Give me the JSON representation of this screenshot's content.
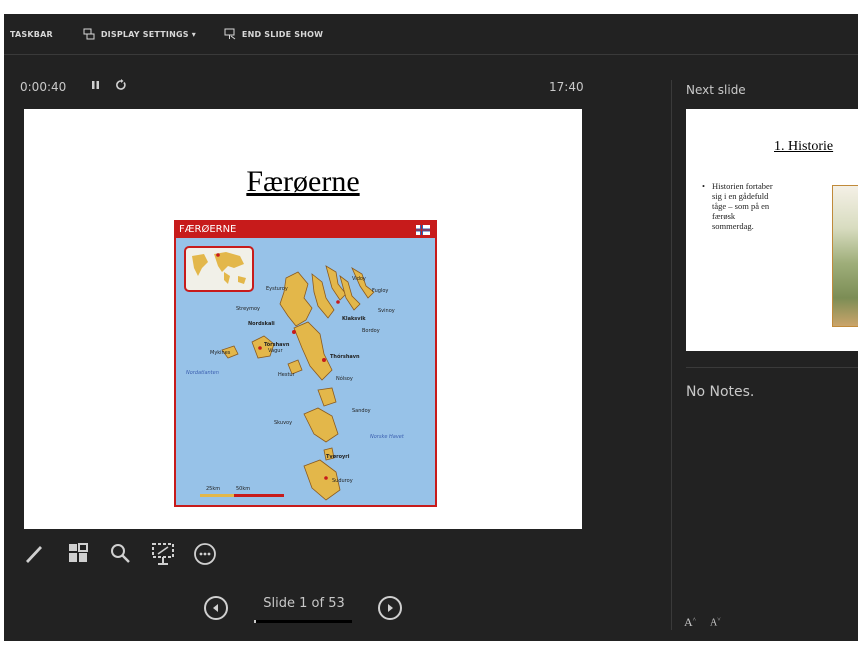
{
  "toolbar": {
    "items": [
      {
        "label": "TASKBAR",
        "icon": "taskbar-icon"
      },
      {
        "label": "DISPLAY SETTINGS ▾",
        "icon": "display-settings-icon"
      },
      {
        "label": "END SLIDE SHOW",
        "icon": "end-slideshow-icon"
      }
    ]
  },
  "presenter": {
    "elapsed": "0:00:40",
    "clock": "17:40",
    "pause_icon": "pause-icon",
    "restart_icon": "restart-icon"
  },
  "current_slide": {
    "title": "Færøerne",
    "map": {
      "header": "FÆRØERNE",
      "places": [
        "Vidoy",
        "Eysturoy",
        "Fugloy",
        "Streymoy",
        "Svinoy",
        "Klaksvik",
        "Nordskali",
        "Tórshavn",
        "Vagur",
        "Bordoy",
        "Mykines",
        "Thórshavn",
        "Hestur",
        "Nólsoy",
        "Sandoy",
        "Skuvoy",
        "Suduroy",
        "Tvøroyri"
      ],
      "seas": [
        "Nordatlanten",
        "Norske Havet"
      ],
      "scale": [
        "25km",
        "50km"
      ]
    }
  },
  "tools": [
    "pen-icon",
    "slides-grid-icon",
    "zoom-icon",
    "presenter-view-icon",
    "more-options-icon"
  ],
  "next_slide": {
    "label": "Next slide",
    "title": "1. Historie",
    "bullet": "•",
    "text": "Historien fortaber\nsig i en gådefuld\ntåge – som på en\nfærøsk\nsommerdag."
  },
  "notes": {
    "text": "No Notes."
  },
  "navigation": {
    "counter": "Slide 1 of 53",
    "progress": 0.02,
    "prev_icon": "prev-slide-icon",
    "next_icon": "next-slide-icon"
  },
  "font_buttons": {
    "increase": "A",
    "decrease": "A"
  },
  "colors": {
    "background": "#222222",
    "map_red": "#c71b1b",
    "sea": "#97c2e8",
    "land": "#e3b74a"
  }
}
